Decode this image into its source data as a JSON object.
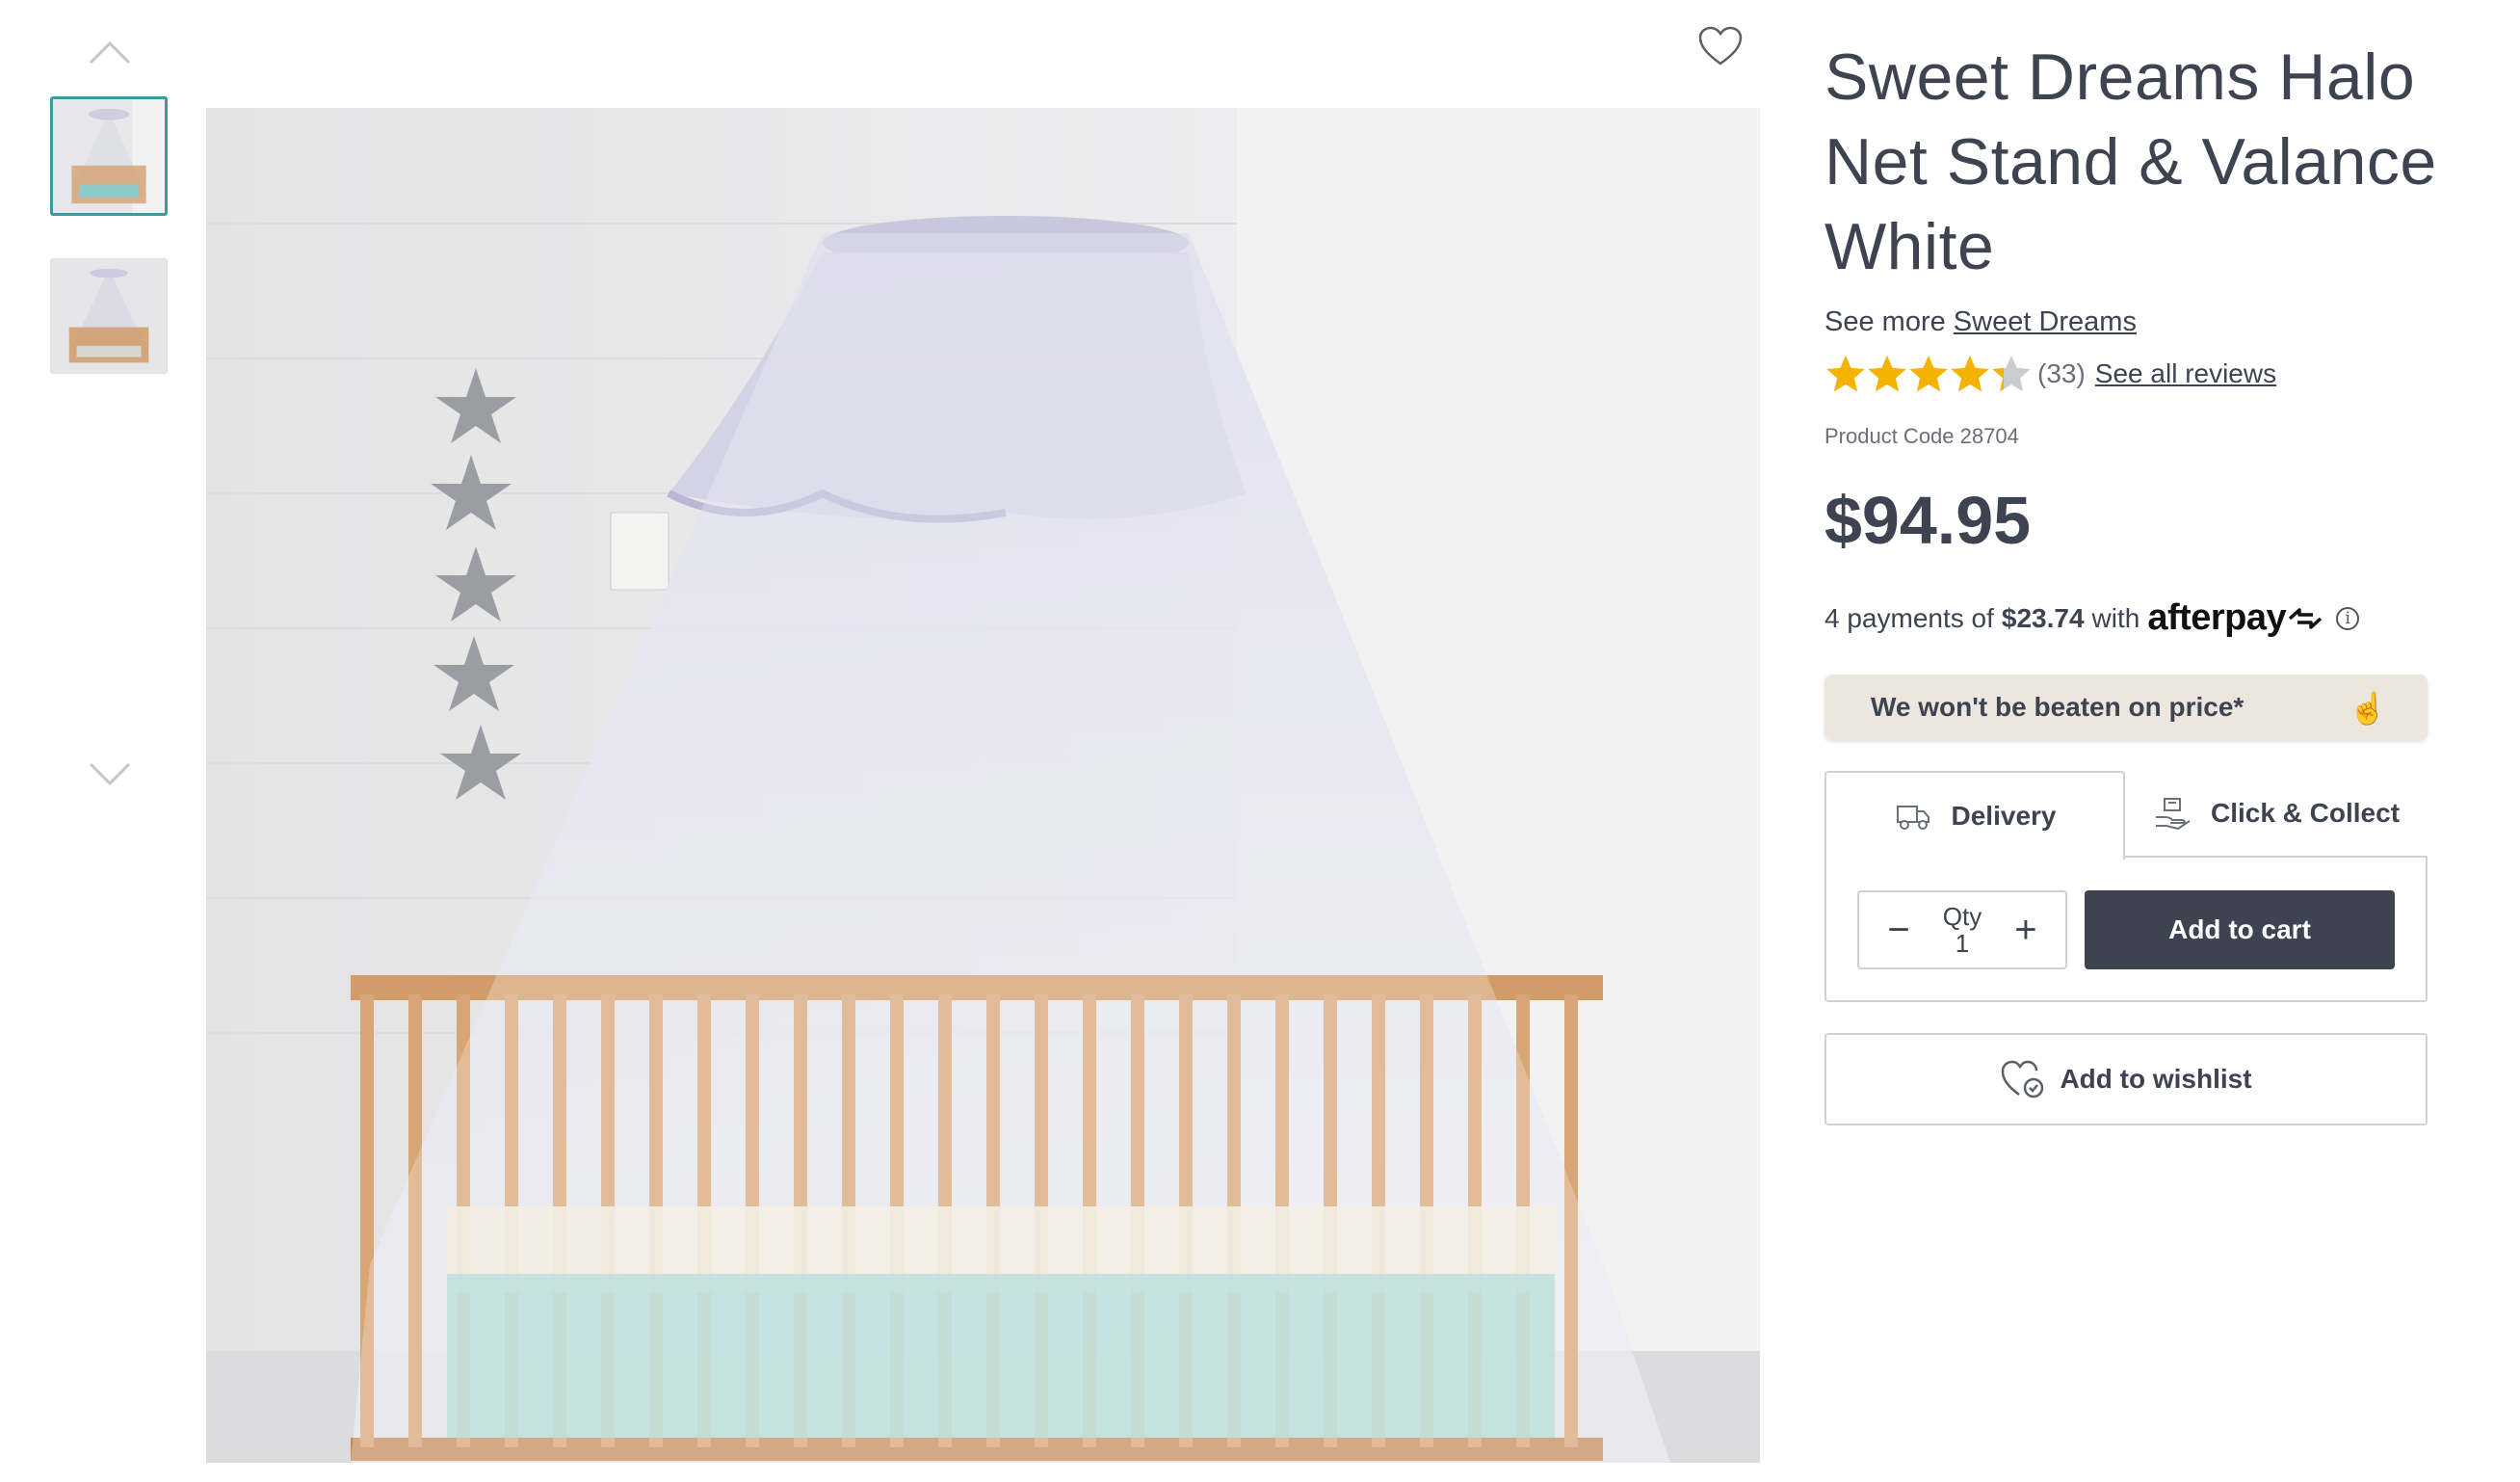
{
  "product": {
    "title": "Sweet Dreams Halo Net Stand & Valance White",
    "see_more_prefix": "See more",
    "brand": "Sweet Dreams",
    "rating": 4.3,
    "review_count": "(33)",
    "see_all_reviews": "See all reviews",
    "product_code": "Product Code 28704",
    "price": "$94.95"
  },
  "afterpay": {
    "prefix": "4 payments of",
    "amount": "$23.74",
    "with": "with",
    "logo_text": "afterpay",
    "info_icon": "info-icon"
  },
  "price_promise": "We won't be beaten on price*",
  "tabs": {
    "delivery": "Delivery",
    "click_collect": "Click & Collect",
    "active": "delivery"
  },
  "quantity": {
    "label": "Qty",
    "value": "1",
    "minus": "−",
    "plus": "+"
  },
  "buttons": {
    "add_to_cart": "Add to cart",
    "add_to_wishlist": "Add to wishlist"
  },
  "gallery": {
    "thumbnail_count": 2,
    "active_index": 0
  },
  "colors": {
    "text": "#3d4350",
    "star": "#f5b301",
    "star_empty": "#c9ccd1",
    "thumb_active_border": "#3a9a9e",
    "promo_bg": "#ede6df",
    "button_dark": "#3d4350"
  }
}
